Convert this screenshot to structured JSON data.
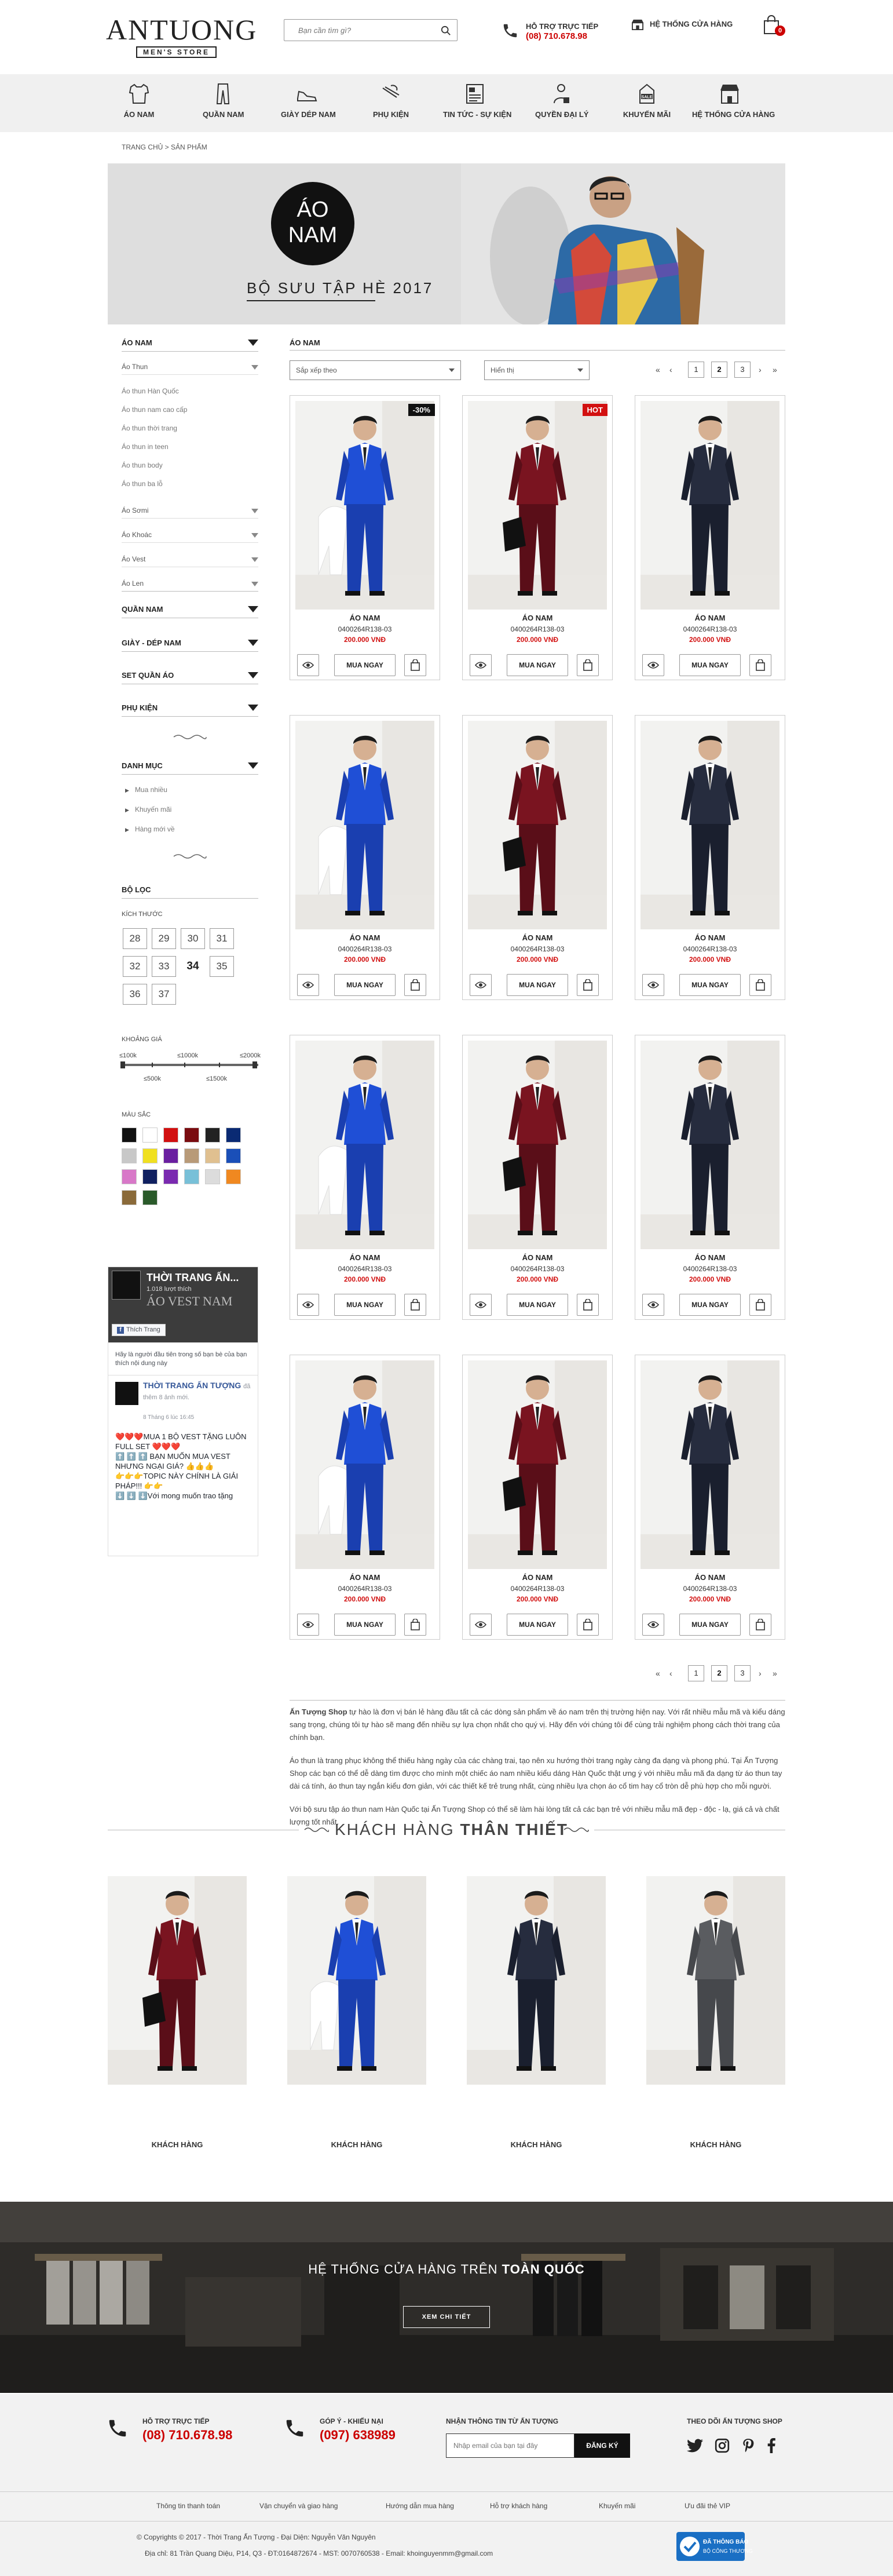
{
  "header": {
    "logo_main": "ANTUONG",
    "logo_sub": "MEN'S STORE",
    "search_placeholder": "Bạn cần tìm gì?",
    "hotline_label": "HỖ TRỢ TRỰC TIẾP",
    "hotline_number": "(08) 710.678.98",
    "store_link": "HỆ THỐNG CỬA HÀNG",
    "cart_count": "0"
  },
  "nav": [
    {
      "label": "ÁO NAM",
      "icon": "shirt-icon"
    },
    {
      "label": "QUẦN NAM",
      "icon": "pants-icon"
    },
    {
      "label": "GIÀY DÉP NAM",
      "icon": "shoe-icon"
    },
    {
      "label": "PHỤ KIỆN",
      "icon": "tie-icon"
    },
    {
      "label": "TIN TỨC - SỰ KIỆN",
      "icon": "newspaper-icon"
    },
    {
      "label": "QUYỀN ĐẠI LÝ",
      "icon": "agent-icon"
    },
    {
      "label": "KHUYẾN MÃI",
      "icon": "sale-tag-icon"
    },
    {
      "label": "HỆ THỐNG CỬA HÀNG",
      "icon": "store-icon"
    }
  ],
  "breadcrumb": "TRANG CHỦ > SẢN PHẨM",
  "banner": {
    "circle_line1": "ÁO",
    "circle_line2": "NAM",
    "title": "BỘ SƯU TẬP HÈ 2017"
  },
  "sidebar": {
    "cat_title": "ÁO NAM",
    "ao_thun": "Áo Thun",
    "ao_thun_sub": [
      "Áo thun Hàn Quốc",
      "Áo thun nam cao cấp",
      "Áo thun thời trang",
      "Áo thun in teen",
      "Áo thun body",
      "Áo thun ba lỗ"
    ],
    "ao_subs": [
      "Áo Sơmi",
      "Áo Khoác",
      "Áo Vest",
      "Áo Len"
    ],
    "main_cats": [
      "QUẦN NAM",
      "GIÀY - DÉP NAM",
      "SET QUẦN ÁO",
      "PHỤ KIỆN"
    ],
    "danh_muc_title": "DANH MỤC",
    "danh_muc": [
      "Mua nhiều",
      "Khuyến mãi",
      "Hàng mới về"
    ],
    "filter_title": "BỘ LỌC",
    "size_title": "KÍCH THƯỚC",
    "sizes": [
      "28",
      "29",
      "30",
      "31",
      "32",
      "33",
      "34",
      "35",
      "36",
      "37"
    ],
    "price_title": "KHOẢNG GIÁ",
    "price_top": [
      "≤100k",
      "≤1000k",
      "≤2000k"
    ],
    "price_bottom": [
      "≤500k",
      "≤1500k"
    ],
    "color_title": "MÀU SẮC",
    "colors": [
      "#111111",
      "#ffffff",
      "#d21010",
      "#7a0c10",
      "#222222",
      "#0a2a73",
      "#c8c8c8",
      "#f0e020",
      "#6a1fa0",
      "#b89a78",
      "#e0c090",
      "#1a4fb8",
      "#d878c8",
      "#102060",
      "#7a2ab0",
      "#78c0d8",
      "#dcdcdc",
      "#f08820",
      "#8a6a3a",
      "#2a5a2a"
    ]
  },
  "fb": {
    "page_title": "THỜI TRANG ẤN...",
    "likes": "1.018 lượt thích",
    "like_btn": "Thích Trang",
    "vest_label": "ÁO VEST NAM",
    "friends": "Hãy là người đầu tiên trong số bạn bè của bạn thích nội dung này",
    "post_title": "THỜI TRANG ẤN TƯỢNG",
    "post_action": "đã thêm 8 ảnh mới.",
    "post_time": "8 Tháng 6 lúc 16:45",
    "post_text1": "❤️❤️❤️MUA 1 BỘ VEST TẶNG LUÔN FULL SET ❤️❤️❤️",
    "post_text2": "⬆️ ⬆️ ⬆️ BẠN MUỐN MUA VEST NHƯNG NGẠI GIÁ? 👍👍👍",
    "post_text3": "👉👉👉TOPIC NÀY CHÍNH LÀ GIẢI PHÁP!!! 👉👉",
    "post_text4": "⬇️ ⬇️ ⬇️Với mong muốn trao tặng"
  },
  "listing": {
    "section_title": "ÁO NAM",
    "sort_label": "Sắp xếp theo",
    "show_label": "Hiển thị",
    "pages": [
      "1",
      "2",
      "3"
    ],
    "current_page": "2",
    "first": "«",
    "prev": "‹",
    "next": "›",
    "last": "»",
    "products": [
      {
        "name": "ÁO NAM",
        "code": "0400264R138-03",
        "price": "200.000 VNĐ",
        "tag": "-30%",
        "color": "blue"
      },
      {
        "name": "ÁO NAM",
        "code": "0400264R138-03",
        "price": "200.000 VNĐ",
        "tag": "HOT",
        "color": "red"
      },
      {
        "name": "ÁO NAM",
        "code": "0400264R138-03",
        "price": "200.000 VNĐ",
        "tag": "",
        "color": "navy"
      },
      {
        "name": "ÁO NAM",
        "code": "0400264R138-03",
        "price": "200.000 VNĐ",
        "tag": "",
        "color": "blue"
      },
      {
        "name": "ÁO NAM",
        "code": "0400264R138-03",
        "price": "200.000 VNĐ",
        "tag": "",
        "color": "red"
      },
      {
        "name": "ÁO NAM",
        "code": "0400264R138-03",
        "price": "200.000 VNĐ",
        "tag": "",
        "color": "navy"
      },
      {
        "name": "ÁO NAM",
        "code": "0400264R138-03",
        "price": "200.000 VNĐ",
        "tag": "",
        "color": "blue"
      },
      {
        "name": "ÁO NAM",
        "code": "0400264R138-03",
        "price": "200.000 VNĐ",
        "tag": "",
        "color": "red"
      },
      {
        "name": "ÁO NAM",
        "code": "0400264R138-03",
        "price": "200.000 VNĐ",
        "tag": "",
        "color": "navy"
      },
      {
        "name": "ÁO NAM",
        "code": "0400264R138-03",
        "price": "200.000 VNĐ",
        "tag": "",
        "color": "blue"
      },
      {
        "name": "ÁO NAM",
        "code": "0400264R138-03",
        "price": "200.000 VNĐ",
        "tag": "",
        "color": "red"
      },
      {
        "name": "ÁO NAM",
        "code": "0400264R138-03",
        "price": "200.000 VNĐ",
        "tag": "",
        "color": "navy"
      }
    ],
    "buy_label": "MUA NGAY"
  },
  "description": [
    {
      "bold": "Ấn Tượng Shop",
      "text": " tự hào là đơn vị bán lẻ hàng đầu tất cả các dòng sản phẩm về áo nam trên thị trường hiện nay. Với rất nhiều mẫu mã và kiểu dáng sang trọng, chúng tôi tự hào sẽ mang đến nhiều sự lựa chọn nhất cho quý vị. Hãy đến với chúng tôi để cùng trải nghiệm phong cách thời trang của chính bạn."
    },
    {
      "bold": "",
      "text": "Áo thun là trang phục không thể thiếu hàng ngày của các chàng trai, tạo nên xu hướng thời trang ngày càng đa dạng và phong phú. Tại Ấn Tượng Shop các bạn có thể dễ dàng tìm được cho mình một chiếc áo nam nhiều kiểu dáng Hàn Quốc thật ưng ý với nhiều mẫu mã đa dạng từ áo thun tay dài cá tính, áo thun tay ngắn kiểu đơn giản, với các thiết kế trẻ trung nhất, cùng nhiều lựa chọn áo cổ tim hay cổ tròn dễ phù hợp cho mỗi người."
    },
    {
      "bold": "",
      "text": "Với bộ sưu tập áo thun nam Hàn Quốc tại Ấn Tượng Shop có thể sẽ làm hài lòng tất cả các bạn trẻ với nhiều mẫu mã đẹp - độc - lạ, giá cả và chất lượng tốt nhất."
    }
  ],
  "customers": {
    "title_light": "KHÁCH HÀNG",
    "title_bold": "THÂN THIẾT",
    "items": [
      {
        "label": "KHÁCH HÀNG"
      },
      {
        "label": "KHÁCH HÀNG"
      },
      {
        "label": "KHÁCH HÀNG"
      },
      {
        "label": "KHÁCH HÀNG"
      }
    ]
  },
  "store_banner": {
    "title_light": "HỆ THỐNG CỬA HÀNG TRÊN",
    "title_bold": "TOÀN QUỐC",
    "button": "XEM CHI TIẾT"
  },
  "footer": {
    "support_label": "HỖ TRỢ TRỰC TIẾP",
    "support_number": "(08) 710.678.98",
    "feedback_label": "GÓP Ý - KHIẾU NẠI",
    "feedback_number": "(097) 638989",
    "newsletter_label": "NHẬN THÔNG TIN TỪ ẤN TƯỢNG",
    "newsletter_placeholder": "Nhập email của bạn tại đây",
    "subscribe_btn": "ĐĂNG KÝ",
    "follow_label": "THEO DÕI ẤN TƯỢNG SHOP",
    "links": [
      "Thông tin thanh toán",
      "Vận chuyển và giao hàng",
      "Hướng dẫn mua hàng",
      "Hỗ trợ khách hàng",
      "Khuyến mãi",
      "Ưu đãi thẻ VIP"
    ],
    "copyright": "© Copyrights © 2017 - Thời Trang Ấn Tượng - Đại Diện: Nguyễn Văn Nguyên",
    "address": "Địa chỉ: 81 Trần Quang Diệu, P14, Q3 - ĐT:0164872674 - MST: 0070760538 - Email: khoinguyenmm@gmail.com",
    "badge_top": "ĐÃ THÔNG BÁO",
    "badge_bottom": "BỘ CÔNG THƯƠNG"
  }
}
